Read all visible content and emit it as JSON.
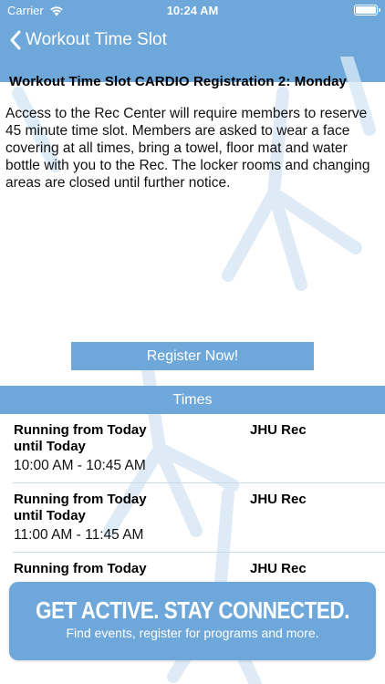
{
  "status_bar": {
    "carrier": "Carrier",
    "time": "10:24 AM"
  },
  "nav": {
    "title": "Workout Time Slot"
  },
  "event": {
    "title": "Workout Time Slot CARDIO Registration 2: Monday",
    "description": "Access to the Rec Center will require members to reserve 45 minute time slot. Members are asked to wear a face covering at all times, bring a towel, floor mat and water bottle with you to the Rec. The locker rooms and changing areas are closed until further notice.",
    "register_label": "Register Now!"
  },
  "times": {
    "header": "Times",
    "rows": [
      {
        "running": "Running from Today until Today",
        "slot": "10:00 AM - 10:45 AM",
        "location": "JHU Rec"
      },
      {
        "running": "Running from Today until Today",
        "slot": "11:00 AM - 11:45 AM",
        "location": "JHU Rec"
      },
      {
        "running": "Running from Today",
        "slot": "",
        "location": "JHU Rec"
      }
    ]
  },
  "promo": {
    "headline": "GET ACTIVE.  STAY CONNECTED.",
    "sub": "Find events, register for programs and more."
  },
  "colors": {
    "accent": "#6ea8da",
    "watermark": "#d6e7f5"
  },
  "icons": {
    "wifi": "wifi-icon",
    "battery": "battery-icon",
    "back": "chevron-left-icon"
  }
}
